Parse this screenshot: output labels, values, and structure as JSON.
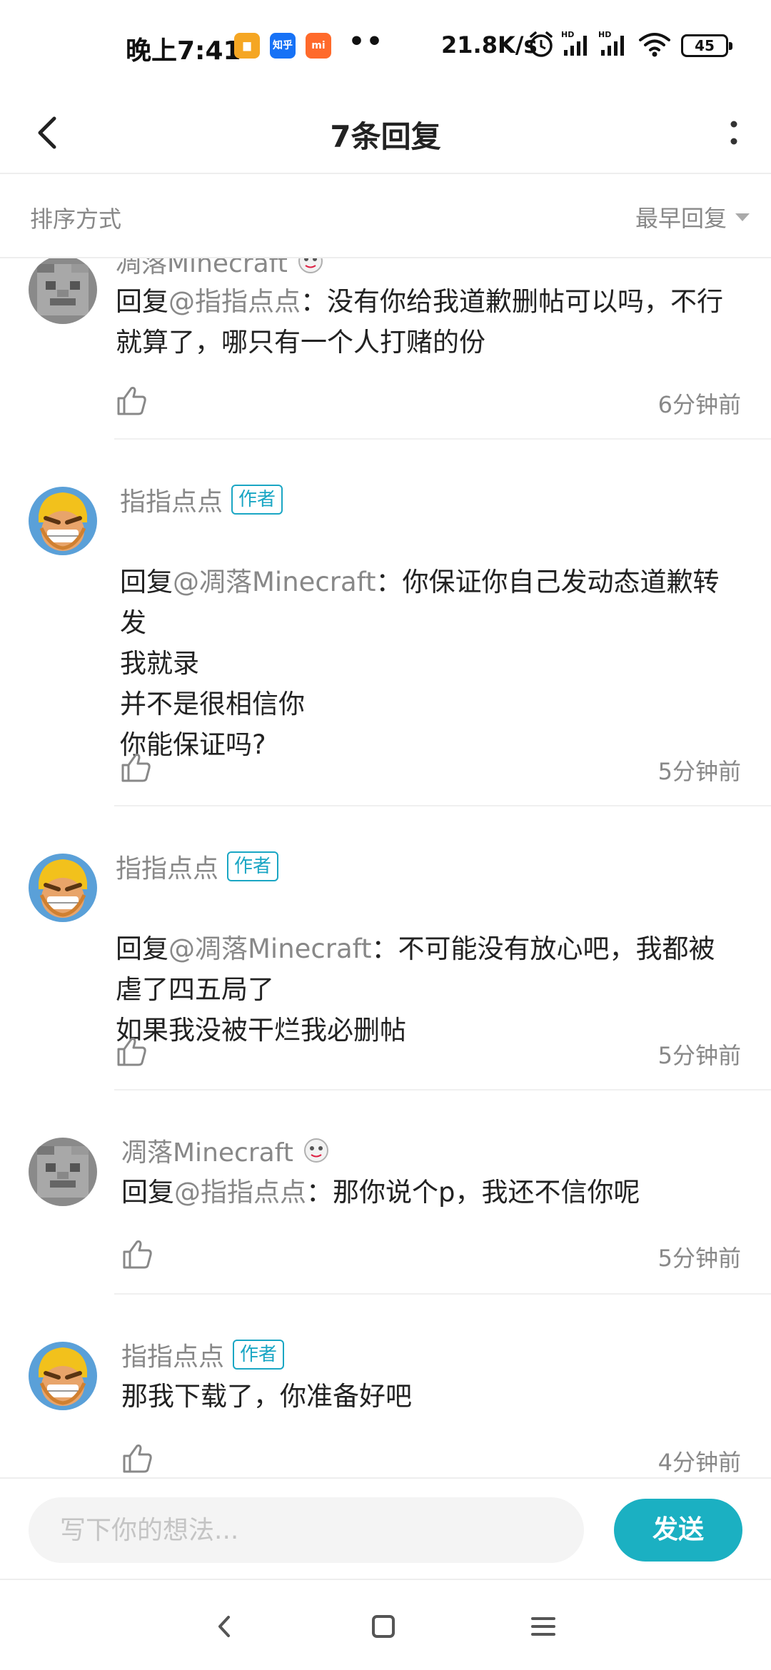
{
  "status_bar": {
    "time": "晚上7:41",
    "app_icons": [
      {
        "name": "gallery-app-icon",
        "label": "",
        "color": "#f5a623"
      },
      {
        "name": "zhihu-app-icon",
        "label": "知乎",
        "color": "#1772f6"
      },
      {
        "name": "mi-app-icon",
        "label": "mi",
        "color": "#ff6a2b"
      }
    ],
    "dots": "••",
    "net_speed": "21.8K/s",
    "battery": "45"
  },
  "header": {
    "title": "7条回复"
  },
  "sort": {
    "label": "排序方式",
    "value": "最早回复"
  },
  "comments": [
    {
      "user": "凋落Minecraft",
      "is_author": false,
      "badge": "",
      "reply_prefix": "回复",
      "mention": "@指指点点",
      "text": "：没有你给我道歉删帖可以吗，不行就算了，哪只有一个人打赌的份",
      "time": "6分钟前",
      "avatar": "pixel-gray"
    },
    {
      "user": "指指点点",
      "is_author": true,
      "badge": "作者",
      "reply_prefix": "回复",
      "mention": "@凋落Minecraft",
      "text": "：你保证你自己发动态道歉转发\n我就录\n并不是很相信你\n你能保证吗?",
      "time": "5分钟前",
      "avatar": "barbarian"
    },
    {
      "user": "指指点点",
      "is_author": true,
      "badge": "作者",
      "reply_prefix": "回复",
      "mention": "@凋落Minecraft",
      "text": "：不可能没有放心吧，我都被虐了四五局了\n如果我没被干烂我必删帖",
      "time": "5分钟前",
      "avatar": "barbarian"
    },
    {
      "user": "凋落Minecraft",
      "is_author": false,
      "badge": "",
      "reply_prefix": "回复",
      "mention": "@指指点点",
      "text": "：那你说个p，我还不信你呢",
      "time": "5分钟前",
      "avatar": "pixel-gray"
    },
    {
      "user": "指指点点",
      "is_author": true,
      "badge": "作者",
      "reply_prefix": "",
      "mention": "",
      "text": "那我下载了，你准备好吧",
      "time": "4分钟前",
      "avatar": "barbarian"
    }
  ],
  "input": {
    "placeholder": "写下你的想法...",
    "send_label": "发送"
  },
  "colors": {
    "accent": "#1bb0c2",
    "badge": "#1aa6c4",
    "muted_text": "#888888"
  },
  "icons": [
    "back-arrow-icon",
    "more-vertical-icon",
    "caret-down-icon",
    "thumbs-up-icon",
    "nav-back-icon",
    "nav-home-icon",
    "nav-menu-icon"
  ]
}
